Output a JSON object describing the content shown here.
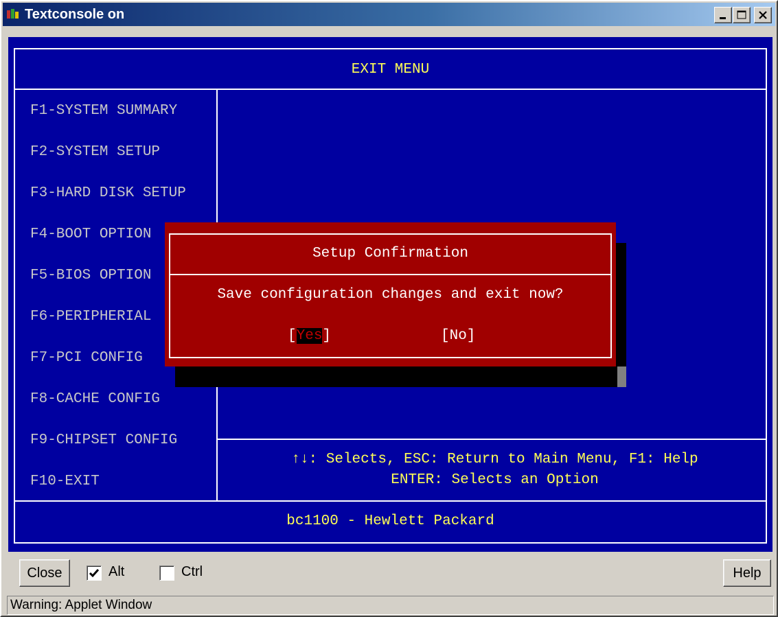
{
  "window": {
    "title": "Textconsole on",
    "minimize_label": "minimize",
    "maximize_label": "maximize",
    "close_label": "close"
  },
  "console": {
    "header": "EXIT MENU",
    "menu_items": [
      "F1-SYSTEM SUMMARY",
      "F2-SYSTEM SETUP",
      "F3-HARD DISK SETUP",
      "F4-BOOT OPTION",
      "F5-BIOS OPTION",
      "F6-PERIPHERIAL",
      "F7-PCI CONFIG",
      "F8-CACHE CONFIG",
      "F9-CHIPSET CONFIG",
      "F10-EXIT"
    ],
    "help_line1": "↑↓: Selects, ESC: Return to Main Menu, F1: Help",
    "help_line2": "ENTER:  Selects an Option",
    "footer": "bc1100 - Hewlett Packard",
    "colors": {
      "background": "#0000a0",
      "highlight_text": "#ffff55",
      "menu_text": "#c8c8c8",
      "dialog_background": "#a00000"
    }
  },
  "dialog": {
    "title": "Setup Confirmation",
    "message": "Save configuration changes and exit now?",
    "yes_open": "[",
    "yes_label": "Yes",
    "yes_close": "]",
    "no_label": "[No]",
    "selected": "Yes"
  },
  "toolbar": {
    "close_label": "Close",
    "alt_label": "Alt",
    "alt_checked": true,
    "ctrl_label": "Ctrl",
    "ctrl_checked": false,
    "help_label": "Help"
  },
  "status_bar": {
    "text": "Warning: Applet Window"
  }
}
